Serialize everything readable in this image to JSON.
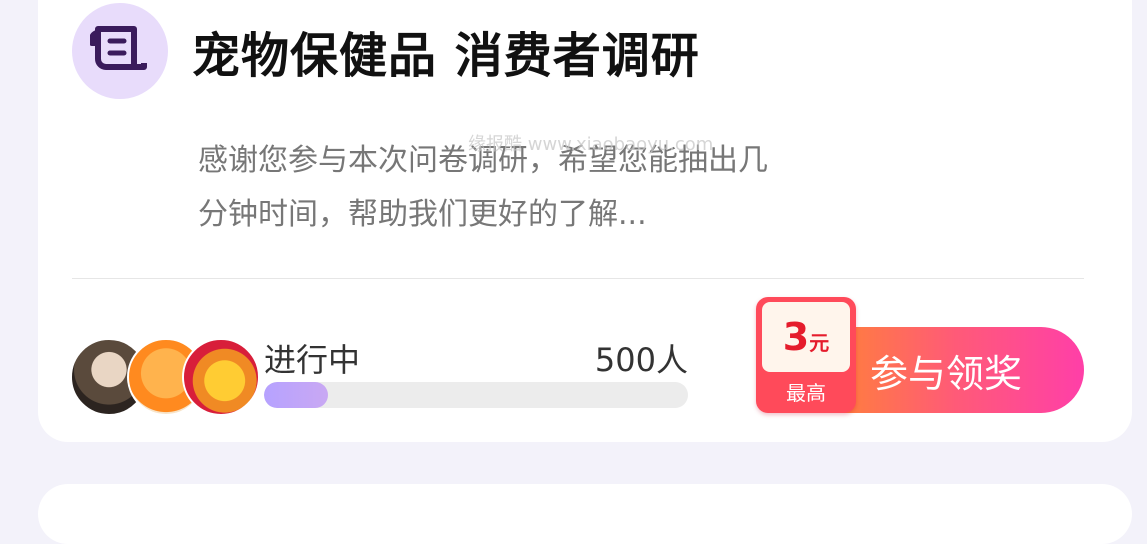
{
  "survey": {
    "title": "宠物保健品 消费者调研",
    "description": "感谢您参与本次问卷调研，希望您能抽出几分钟时间，帮助我们更好的了解...",
    "watermark": "缘报酷 www.xiaobaoyu.com",
    "status": "进行中",
    "participants": "500人",
    "progress_fraction": 0.15,
    "icon": "scroll-icon",
    "avatars": [
      "avatar-girl",
      "avatar-orange-mascot",
      "avatar-coin-mascot"
    ]
  },
  "reward": {
    "amount": "3",
    "unit": "元",
    "label": "最高"
  },
  "action": {
    "join_label": "参与领奖"
  },
  "colors": {
    "accent": "#ff3fa8",
    "progress": "#b6a2ff",
    "reward": "#e51c2c"
  }
}
